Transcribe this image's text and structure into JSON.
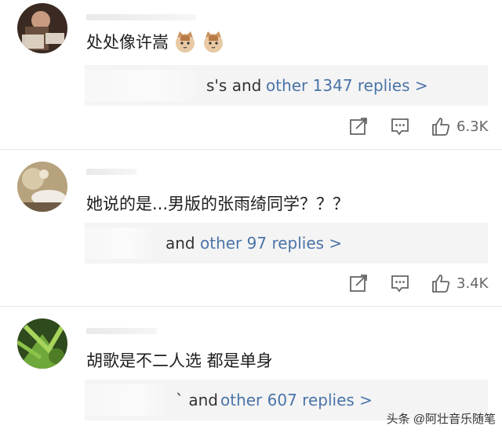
{
  "comments": [
    {
      "text": "处处像许嵩",
      "emoji": [
        "cat-emoji-icon",
        "cat-emoji-icon"
      ],
      "reply_prefix": "s's and",
      "reply_link": "other 1347 replies >",
      "likes": "6.3K"
    },
    {
      "text": "她说的是...男版的张雨绮同学？？？",
      "reply_prefix": "and",
      "reply_link": "other 97 replies >",
      "likes": "3.4K"
    },
    {
      "text": "胡歌是不二人选 都是单身",
      "reply_prefix": "` and",
      "reply_link": "other 607 replies >"
    }
  ],
  "watermark": "头条 @阿壮音乐随笔",
  "colors": {
    "link": "#4a74a8",
    "reply_bg": "#f4f4f4",
    "divider": "#e6e6e6"
  }
}
